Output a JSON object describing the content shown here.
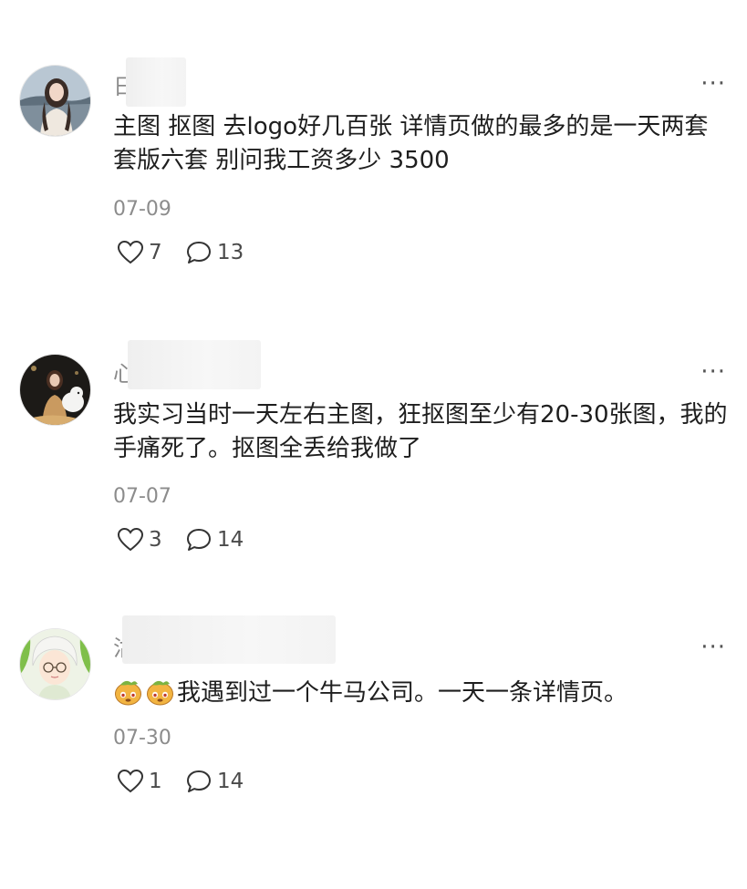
{
  "comments": [
    {
      "name_visible": "日",
      "text": "主图 抠图 去logo好几百张 详情页做的最多的是一天两套 套版六套 别问我工资多少 3500",
      "date": "07-09",
      "likes": "7",
      "replies": "13",
      "more_label": "···"
    },
    {
      "name_visible": "心",
      "text": "我实习当时一天左右主图，狂抠图至少有20-30张图，我的手痛死了。抠图全丢给我做了",
      "date": "07-07",
      "likes": "3",
      "replies": "14",
      "more_label": "···"
    },
    {
      "name_visible": "沽",
      "text": "我遇到过一个牛马公司。一天一条详情页。",
      "date": "07-30",
      "likes": "1",
      "replies": "14",
      "more_label": "···"
    }
  ]
}
